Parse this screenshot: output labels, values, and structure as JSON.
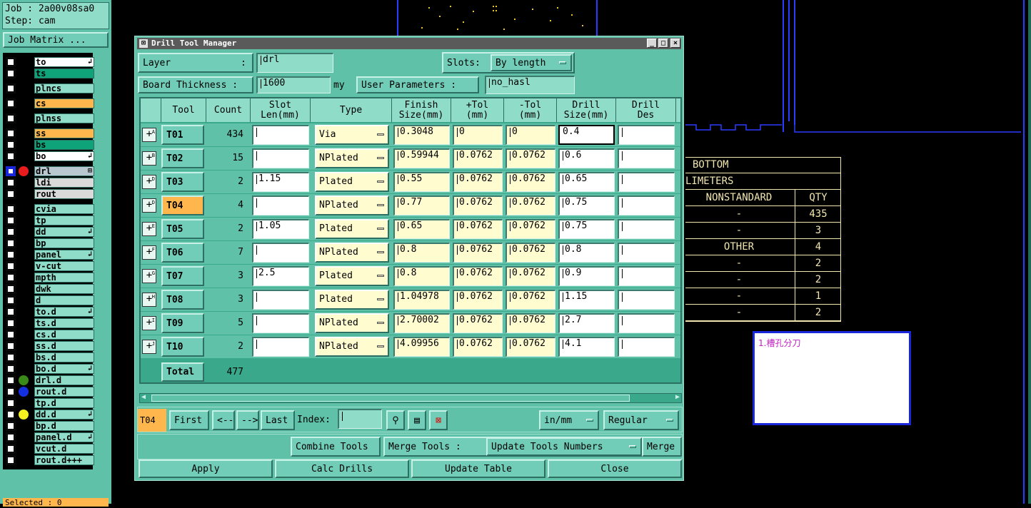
{
  "job_box": {
    "job": "Job : 2a00v08sa0",
    "step": "Step: cam",
    "matrix_button": "Job Matrix ..."
  },
  "layers": [
    {
      "name": "to",
      "color": "#ffffff",
      "arrow": "↲",
      "group": 1
    },
    {
      "name": "ts",
      "color": "#0fa37a",
      "group": 1
    },
    {
      "name": "plncs",
      "color": "#8fdcc8",
      "group": 2
    },
    {
      "name": "cs",
      "color": "#ffb74d",
      "group": 3
    },
    {
      "name": "plnss",
      "color": "#8fdcc8",
      "group": 4
    },
    {
      "name": "ss",
      "color": "#ffb74d",
      "group": 5
    },
    {
      "name": "bs",
      "color": "#0fa37a",
      "group": 5
    },
    {
      "name": "bo",
      "color": "#ffffff",
      "arrow": "↲",
      "group": 5
    },
    {
      "name": "drl",
      "color": "#b9c8d0",
      "dot": "#e81c1c",
      "selected": true,
      "arrow": "⊞",
      "group": 6
    },
    {
      "name": "ldi",
      "color": "#d9d9d9",
      "group": 6
    },
    {
      "name": "rout",
      "color": "#d9d9d9",
      "group": 6
    },
    {
      "name": "cvia",
      "color": "#8fdcc8",
      "group": 7
    },
    {
      "name": "tp",
      "color": "#8fdcc8",
      "group": 7
    },
    {
      "name": "dd",
      "color": "#8fdcc8",
      "arrow": "↲",
      "group": 7
    },
    {
      "name": "bp",
      "color": "#8fdcc8",
      "group": 7
    },
    {
      "name": "panel",
      "color": "#8fdcc8",
      "arrow": "↲",
      "group": 7
    },
    {
      "name": "v-cut",
      "color": "#8fdcc8",
      "group": 7
    },
    {
      "name": "mpth",
      "color": "#8fdcc8",
      "group": 7
    },
    {
      "name": "dwk",
      "color": "#8fdcc8",
      "group": 7
    },
    {
      "name": "d",
      "color": "#8fdcc8",
      "group": 7
    },
    {
      "name": "to.d",
      "color": "#8fdcc8",
      "arrow": "↲",
      "group": 7
    },
    {
      "name": "ts.d",
      "color": "#8fdcc8",
      "group": 7
    },
    {
      "name": "cs.d",
      "color": "#8fdcc8",
      "group": 7
    },
    {
      "name": "ss.d",
      "color": "#8fdcc8",
      "group": 7
    },
    {
      "name": "bs.d",
      "color": "#8fdcc8",
      "group": 7
    },
    {
      "name": "bo.d",
      "color": "#8fdcc8",
      "arrow": "↲",
      "group": 7
    },
    {
      "name": "drl.d",
      "color": "#8fdcc8",
      "dot": "#3a8a1a",
      "group": 7
    },
    {
      "name": "rout.d",
      "color": "#8fdcc8",
      "dot": "#1530e0",
      "group": 7
    },
    {
      "name": "tp.d",
      "color": "#8fdcc8",
      "group": 7
    },
    {
      "name": "dd.d",
      "color": "#8fdcc8",
      "dot": "#f5f020",
      "arrow": "↲",
      "group": 7
    },
    {
      "name": "bp.d",
      "color": "#8fdcc8",
      "group": 7
    },
    {
      "name": "panel.d",
      "color": "#8fdcc8",
      "arrow": "↲",
      "group": 7
    },
    {
      "name": "vcut.d",
      "color": "#8fdcc8",
      "group": 7
    },
    {
      "name": "rout.d+++",
      "color": "#8fdcc8",
      "group": 7
    }
  ],
  "selected_label": "Selected : 0",
  "dialog": {
    "title": "Drill Tool Manager",
    "layer_label": "Layer",
    "layer_colon": ":",
    "layer_value": "drl",
    "slots_label": "Slots:",
    "slots_value": "By length",
    "thickness_label": "Board Thickness :",
    "thickness_value": "1600",
    "thickness_unit": "my",
    "user_params_label": "User Parameters :",
    "user_params_value": "no_hasl",
    "columns": [
      "Tool",
      "Count",
      "Slot\nLen(mm)",
      "Type",
      "Finish\nSize(mm)",
      "+Tol\n(mm)",
      "-Tol\n(mm)",
      "Drill\nSize(mm)",
      "Drill\nDes"
    ],
    "rows": [
      {
        "sup": "A",
        "tool": "T01",
        "count": "434",
        "slot": "",
        "type": "Via",
        "finish": "0.3048",
        "ptol": "0",
        "ntol": "0",
        "drill": "0.4",
        "des": ""
      },
      {
        "sup": "B",
        "tool": "T02",
        "count": "15",
        "slot": "",
        "type": "NPlated",
        "finish": "0.59944",
        "ptol": "0.0762",
        "ntol": "0.0762",
        "drill": "0.6",
        "des": ""
      },
      {
        "sup": "D",
        "tool": "T03",
        "count": "2",
        "slot": "1.15",
        "type": "Plated",
        "finish": "0.55",
        "ptol": "0.0762",
        "ntol": "0.0762",
        "drill": "0.65",
        "des": ""
      },
      {
        "sup": "D",
        "tool": "T04",
        "count": "4",
        "slot": "",
        "type": "NPlated",
        "finish": "0.77",
        "ptol": "0.0762",
        "ntol": "0.0762",
        "drill": "0.75",
        "des": "",
        "active": true
      },
      {
        "sup": "E",
        "tool": "T05",
        "count": "2",
        "slot": "1.05",
        "type": "Plated",
        "finish": "0.65",
        "ptol": "0.0762",
        "ntol": "0.0762",
        "drill": "0.75",
        "des": ""
      },
      {
        "sup": "F",
        "tool": "T06",
        "count": "7",
        "slot": "",
        "type": "NPlated",
        "finish": "0.8",
        "ptol": "0.0762",
        "ntol": "0.0762",
        "drill": "0.8",
        "des": ""
      },
      {
        "sup": "G",
        "tool": "T07",
        "count": "3",
        "slot": "2.5",
        "type": "Plated",
        "finish": "0.8",
        "ptol": "0.0762",
        "ntol": "0.0762",
        "drill": "0.9",
        "des": ""
      },
      {
        "sup": "H",
        "tool": "T08",
        "count": "3",
        "slot": "",
        "type": "Plated",
        "finish": "1.04978",
        "ptol": "0.0762",
        "ntol": "0.0762",
        "drill": "1.15",
        "des": ""
      },
      {
        "sup": "I",
        "tool": "T09",
        "count": "5",
        "slot": "",
        "type": "NPlated",
        "finish": "2.70002",
        "ptol": "0.0762",
        "ntol": "0.0762",
        "drill": "2.7",
        "des": ""
      },
      {
        "sup": "J",
        "tool": "T10",
        "count": "2",
        "slot": "",
        "type": "NPlated",
        "finish": "4.09956",
        "ptol": "0.0762",
        "ntol": "0.0762",
        "drill": "4.1",
        "des": ""
      }
    ],
    "total_label": "Total",
    "total_count": "477",
    "nav": {
      "current": "T04",
      "first": "First",
      "prev": "<--",
      "next": "-->",
      "last": "Last",
      "index_label": "Index:",
      "units": "in/mm",
      "mode": "Regular"
    },
    "combine_tools": "Combine Tools",
    "merge_tools_label": "Merge Tools :",
    "merge_tools_value": "Update Tools Numbers",
    "merge_button": "Merge",
    "apply": "Apply",
    "calc_drills": "Calc Drills",
    "update_table": "Update Table",
    "close": "Close"
  },
  "right_table": {
    "rows": [
      {
        "a": "BOTTOM",
        "b": ""
      },
      {
        "a": "LIMETERS",
        "b": ""
      },
      {
        "a": "NONSTANDARD",
        "b": "QTY"
      },
      {
        "a": "-",
        "b": "435"
      },
      {
        "a": "-",
        "b": "3"
      },
      {
        "a": "OTHER",
        "b": "4"
      },
      {
        "a": "-",
        "b": "2"
      },
      {
        "a": "-",
        "b": "2"
      },
      {
        "a": "-",
        "b": "1"
      },
      {
        "a": "-",
        "b": "2"
      }
    ]
  },
  "note_box": {
    "text": "1.槽孔分刀"
  }
}
